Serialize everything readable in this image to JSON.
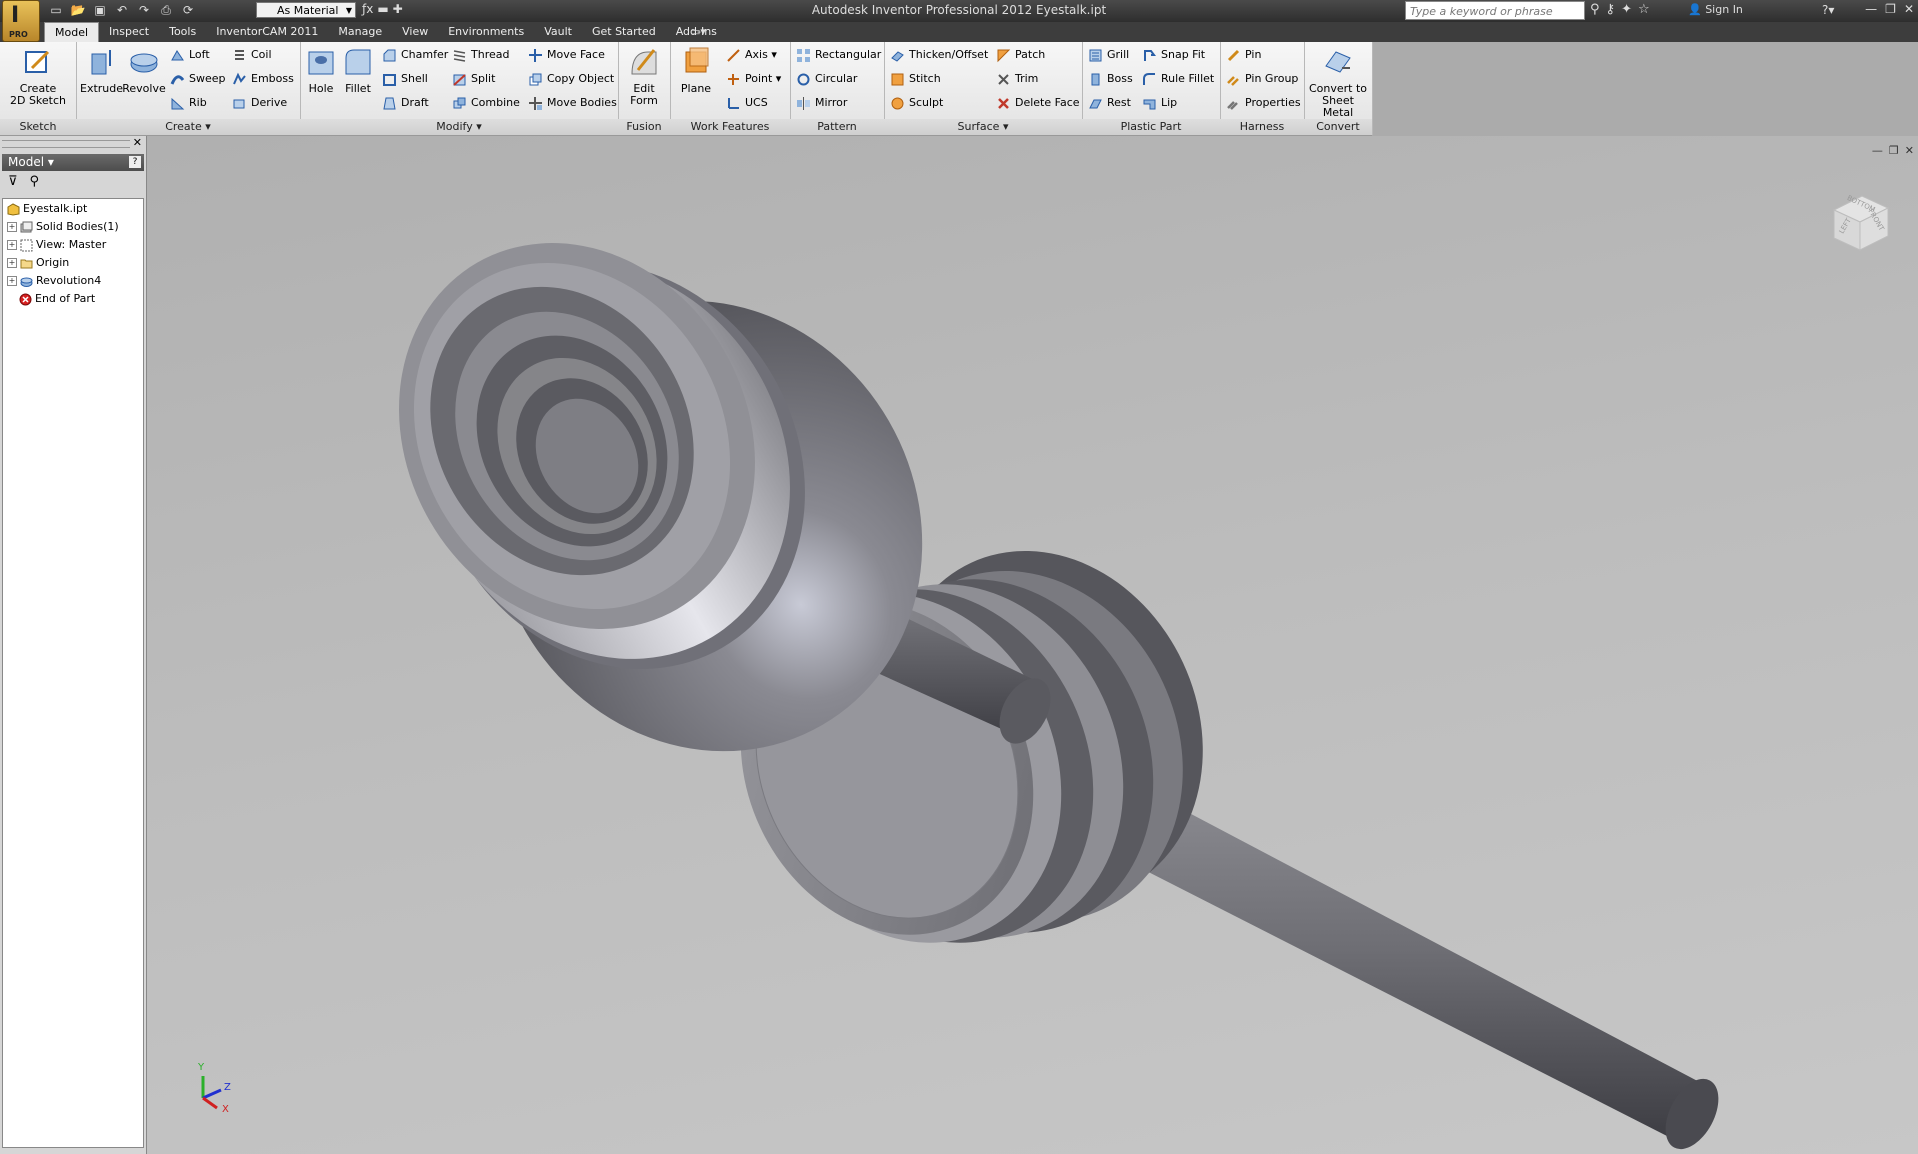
{
  "window": {
    "title": "Autodesk Inventor Professional 2012    Eyestalk.ipt",
    "search_placeholder": "Type a keyword or phrase",
    "sign_in": "Sign In",
    "app_badge": "PRO"
  },
  "quick_access": {
    "material": "As Material"
  },
  "tabs": [
    "Model",
    "Inspect",
    "Tools",
    "InventorCAM 2011",
    "Manage",
    "View",
    "Environments",
    "Vault",
    "Get Started",
    "Add-Ins"
  ],
  "ribbon": {
    "sketch": {
      "label": "Sketch",
      "create_2d_sketch": "Create\n2D Sketch"
    },
    "create": {
      "label": "Create",
      "extrude": "Extrude",
      "revolve": "Revolve",
      "loft": "Loft",
      "sweep": "Sweep",
      "rib": "Rib",
      "coil": "Coil",
      "emboss": "Emboss",
      "derive": "Derive"
    },
    "modify": {
      "label": "Modify",
      "hole": "Hole",
      "fillet": "Fillet",
      "chamfer": "Chamfer",
      "shell": "Shell",
      "draft": "Draft",
      "thread": "Thread",
      "split": "Split",
      "combine": "Combine",
      "move_face": "Move Face",
      "copy_object": "Copy Object",
      "move_bodies": "Move Bodies"
    },
    "fusion": {
      "label": "Fusion",
      "edit_form": "Edit\nForm"
    },
    "work_features": {
      "label": "Work Features",
      "plane": "Plane",
      "axis": "Axis",
      "point": "Point",
      "ucs": "UCS"
    },
    "pattern": {
      "label": "Pattern",
      "rectangular": "Rectangular",
      "circular": "Circular",
      "mirror": "Mirror"
    },
    "surface": {
      "label": "Surface",
      "thicken_offset": "Thicken/Offset",
      "stitch": "Stitch",
      "sculpt": "Sculpt",
      "patch": "Patch",
      "trim": "Trim",
      "delete_face": "Delete Face"
    },
    "plastic_part": {
      "label": "Plastic Part",
      "grill": "Grill",
      "boss": "Boss",
      "rest": "Rest",
      "snap_fit": "Snap Fit",
      "rule_fillet": "Rule Fillet",
      "lip": "Lip"
    },
    "harness": {
      "label": "Harness",
      "pin": "Pin",
      "pin_group": "Pin Group",
      "properties": "Properties"
    },
    "convert": {
      "label": "Convert",
      "convert_to_sheet_metal": "Convert to\nSheet Metal"
    }
  },
  "browser": {
    "title": "Model",
    "tree": [
      "Eyestalk.ipt",
      "Solid Bodies(1)",
      "View: Master",
      "Origin",
      "Revolution4",
      "End of Part"
    ]
  },
  "viewcube": {
    "left": "LEFT",
    "front": "FRONT",
    "bottom": "BOTTOM"
  },
  "axes": {
    "x": "X",
    "y": "Y",
    "z": "Z"
  }
}
